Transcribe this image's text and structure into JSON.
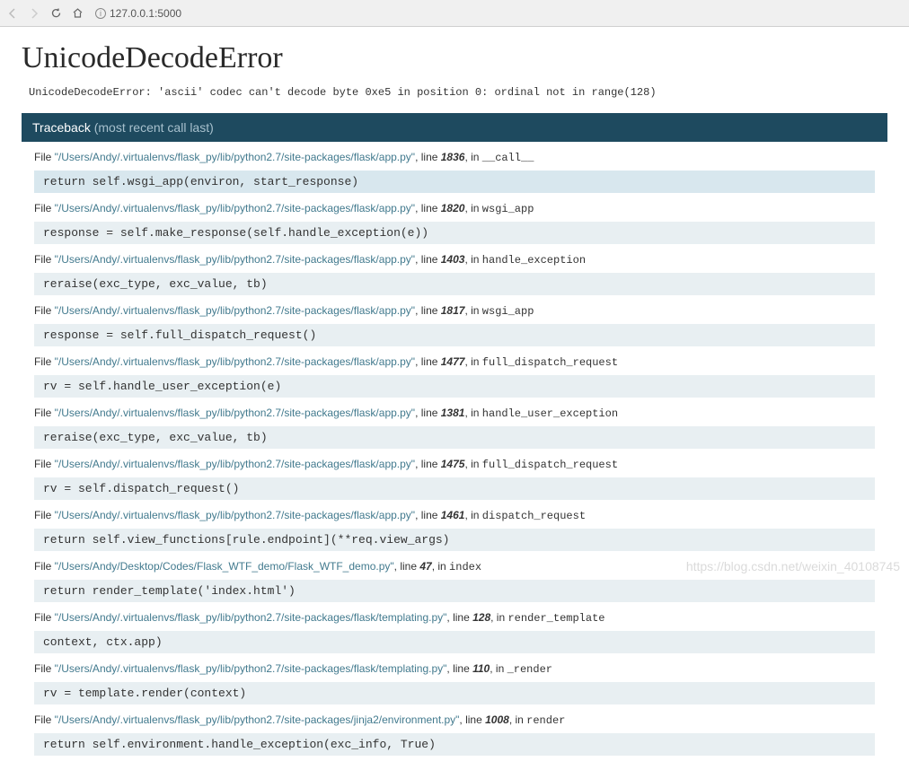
{
  "browser": {
    "url": "127.0.0.1:5000"
  },
  "page": {
    "title": "UnicodeDecodeError",
    "error_message": "UnicodeDecodeError: 'ascii' codec can't decode byte 0xe5 in position 0: ordinal not in range(128)"
  },
  "traceback": {
    "label": "Traceback",
    "sublabel": "(most recent call last)",
    "file_prefix": "File ",
    "line_prefix": ", line ",
    "in_prefix": ", in ",
    "frames": [
      {
        "path": "\"/Users/Andy/.virtualenvs/flask_py/lib/python2.7/site-packages/flask/app.py\"",
        "line": "1836",
        "fn": "__call__",
        "code": "return self.wsgi_app(environ, start_response)",
        "highlighted": true
      },
      {
        "path": "\"/Users/Andy/.virtualenvs/flask_py/lib/python2.7/site-packages/flask/app.py\"",
        "line": "1820",
        "fn": "wsgi_app",
        "code": "response = self.make_response(self.handle_exception(e))"
      },
      {
        "path": "\"/Users/Andy/.virtualenvs/flask_py/lib/python2.7/site-packages/flask/app.py\"",
        "line": "1403",
        "fn": "handle_exception",
        "code": "reraise(exc_type, exc_value, tb)"
      },
      {
        "path": "\"/Users/Andy/.virtualenvs/flask_py/lib/python2.7/site-packages/flask/app.py\"",
        "line": "1817",
        "fn": "wsgi_app",
        "code": "response = self.full_dispatch_request()"
      },
      {
        "path": "\"/Users/Andy/.virtualenvs/flask_py/lib/python2.7/site-packages/flask/app.py\"",
        "line": "1477",
        "fn": "full_dispatch_request",
        "code": "rv = self.handle_user_exception(e)"
      },
      {
        "path": "\"/Users/Andy/.virtualenvs/flask_py/lib/python2.7/site-packages/flask/app.py\"",
        "line": "1381",
        "fn": "handle_user_exception",
        "code": "reraise(exc_type, exc_value, tb)"
      },
      {
        "path": "\"/Users/Andy/.virtualenvs/flask_py/lib/python2.7/site-packages/flask/app.py\"",
        "line": "1475",
        "fn": "full_dispatch_request",
        "code": "rv = self.dispatch_request()"
      },
      {
        "path": "\"/Users/Andy/.virtualenvs/flask_py/lib/python2.7/site-packages/flask/app.py\"",
        "line": "1461",
        "fn": "dispatch_request",
        "code": "return self.view_functions[rule.endpoint](**req.view_args)"
      },
      {
        "path": "\"/Users/Andy/Desktop/Codes/Flask_WTF_demo/Flask_WTF_demo.py\"",
        "line": "47",
        "fn": "index",
        "code": "return render_template('index.html')"
      },
      {
        "path": "\"/Users/Andy/.virtualenvs/flask_py/lib/python2.7/site-packages/flask/templating.py\"",
        "line": "128",
        "fn": "render_template",
        "code": "context, ctx.app)"
      },
      {
        "path": "\"/Users/Andy/.virtualenvs/flask_py/lib/python2.7/site-packages/flask/templating.py\"",
        "line": "110",
        "fn": "_render",
        "code": "rv = template.render(context)"
      },
      {
        "path": "\"/Users/Andy/.virtualenvs/flask_py/lib/python2.7/site-packages/jinja2/environment.py\"",
        "line": "1008",
        "fn": "render",
        "code": "return self.environment.handle_exception(exc_info, True)"
      }
    ]
  },
  "watermark": "https://blog.csdn.net/weixin_40108745"
}
